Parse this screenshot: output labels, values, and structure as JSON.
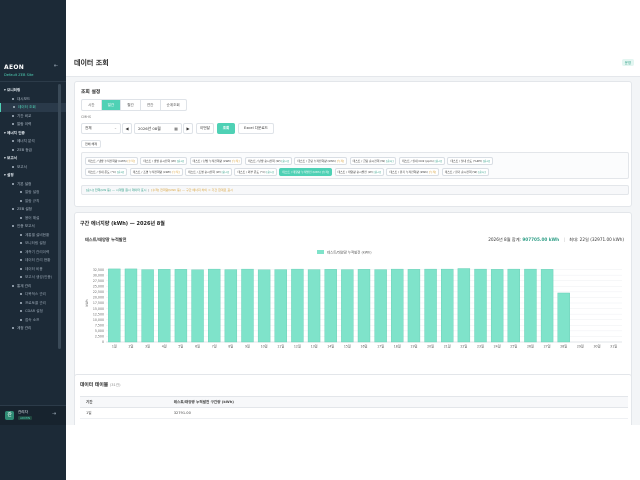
{
  "app": {
    "logo": "AEON",
    "site": "Default ZEB Site",
    "collapse_icon": "chevron-left-icon"
  },
  "sidebar": {
    "items": [
      {
        "label": "모니터링",
        "type": "group"
      },
      {
        "label": "대시보드",
        "type": "item"
      },
      {
        "label": "데이터 조회",
        "type": "item",
        "active": true
      },
      {
        "label": "기간 비교",
        "type": "item"
      },
      {
        "label": "알람 이력",
        "type": "item"
      },
      {
        "label": "에너지 인증",
        "type": "group"
      },
      {
        "label": "에너지 분석",
        "type": "item"
      },
      {
        "label": "ZEB 등급",
        "type": "item"
      },
      {
        "label": "보고서",
        "type": "group"
      },
      {
        "label": "보고서",
        "type": "item"
      },
      {
        "label": "설정",
        "type": "group"
      },
      {
        "label": "기본 설정",
        "type": "item"
      },
      {
        "label": "알람 설정",
        "type": "sub"
      },
      {
        "label": "알람 규칙",
        "type": "sub"
      },
      {
        "label": "ZEB 설정",
        "type": "item"
      },
      {
        "label": "용어 해설",
        "type": "sub"
      },
      {
        "label": "인증 보고서",
        "type": "item"
      },
      {
        "label": "계통별 설비현황",
        "type": "sub"
      },
      {
        "label": "모니터링 설정",
        "type": "sub"
      },
      {
        "label": "계측기 관리이력",
        "type": "sub"
      },
      {
        "label": "데이터 관리 현황",
        "type": "sub"
      },
      {
        "label": "데이터 비용",
        "type": "sub"
      },
      {
        "label": "보고서 생성(인증)",
        "type": "sub"
      },
      {
        "label": "통계 관리",
        "type": "item"
      },
      {
        "label": "다목적스 관리",
        "type": "sub"
      },
      {
        "label": "프로토콜 관리",
        "type": "sub"
      },
      {
        "label": "CDAR 설정",
        "type": "sub"
      },
      {
        "label": "접속 소프",
        "type": "sub"
      },
      {
        "label": "계정 관리",
        "type": "item"
      }
    ],
    "user": {
      "avatar": "관",
      "name": "관리자",
      "role": "ADMIN",
      "logout_icon": "logout-icon"
    }
  },
  "page": {
    "title": "데이터 조회",
    "env_badge": "운영"
  },
  "query": {
    "title": "조회 설정",
    "tabs": [
      "시간",
      "일간",
      "월간",
      "연간",
      "순계조회"
    ],
    "active_tab": "일간",
    "category_label": "CMHS",
    "category_value": "전체",
    "month_value": "2026년 08월",
    "this_month": "이번달",
    "search": "조회",
    "excel": "Excel 다운로드",
    "select_all": "전체 해제",
    "tags_row1": [
      {
        "label": "테스트 / 냉방 누적전력량 (kWh)",
        "unit": "[누적]",
        "warn": true
      },
      {
        "label": "테스트 / 냉방 순시전력 (W)",
        "unit": "[순시]"
      },
      {
        "label": "테스트 / 난방 누적전력량 (kWh)",
        "unit": "[누적]",
        "warn": true
      },
      {
        "label": "테스트 / 난방 순시전력 (W)",
        "unit": "[순시]"
      },
      {
        "label": "테스트 / 급탕 누적전력량 (kWh)",
        "unit": "[누적]",
        "warn": true
      },
      {
        "label": "테스트 / 급탕 순시전력 (W)",
        "unit": "[순시]"
      },
      {
        "label": "테스트 / 실내 CO2 (ppm)",
        "unit": "[순시]"
      },
      {
        "label": "테스트 / 실내 습도 (%RH)",
        "unit": "[순시]"
      }
    ],
    "tags_row2": [
      {
        "label": "테스트 / 실내 온도 (°C)",
        "unit": "[순시]"
      },
      {
        "label": "테스트 / 조명 누적전력량 (kWh)",
        "unit": "[누적]",
        "warn": true
      },
      {
        "label": "테스트 / 조명 순시전력 (W)",
        "unit": "[순시]"
      },
      {
        "label": "테스트 / 외부 온도 (°C)",
        "unit": "[순시]"
      },
      {
        "label": "테스트 / 태양광 누적발전 (kWh)",
        "unit": "[누적]",
        "selected": true
      },
      {
        "label": "테스트 / 태양광 순시발전 (W)",
        "unit": "[순시]"
      },
      {
        "label": "테스트 / 환기 누적전력량 (kWh)",
        "unit": "[누적]",
        "warn": true
      },
      {
        "label": "테스트 / 환기 순시전력 (W)",
        "unit": "[순시]"
      }
    ],
    "hint_a": "[순시] 전력(kW 등) — 시계열 원시 데이터 표시",
    "hint_b": "[누적] 전력량(kWh 등) — 구간 에너지 차이 = 기간 합계로 표시"
  },
  "chart_section": {
    "heading": "구간 에너지량 (kWh) — 2026년 8월",
    "sub": "테스트/태양광 누적발전",
    "total_label": "2026년 8월 합계:",
    "total_value": "907705.00 kWh",
    "max_label": "최대: 22일 (32971.00 kWh)"
  },
  "chart_data": {
    "type": "bar",
    "legend": [
      "테스트/태양광 누적발전 (kWh)"
    ],
    "ylabel": "kWh",
    "ylim": [
      0,
      35000
    ],
    "yticks": [
      "0",
      "2,500",
      "5,000",
      "7,500",
      "10,000",
      "12,500",
      "15,000",
      "17,500",
      "20,000",
      "22,500",
      "25,000",
      "27,500",
      "30,000",
      "32,500"
    ],
    "ytick_values": [
      0,
      2500,
      5000,
      7500,
      10000,
      12500,
      15000,
      17500,
      20000,
      22500,
      25000,
      27500,
      30000,
      32500
    ],
    "categories": [
      "1일",
      "2일",
      "3일",
      "4일",
      "5일",
      "6일",
      "7일",
      "8일",
      "9일",
      "10일",
      "11일",
      "12일",
      "13일",
      "14일",
      "15일",
      "16일",
      "17일",
      "18일",
      "19일",
      "20일",
      "21일",
      "22일",
      "23일",
      "24일",
      "25일",
      "26일",
      "27일",
      "28일",
      "29일",
      "30일",
      "31일"
    ],
    "values": [
      32800,
      32800,
      32500,
      32600,
      32600,
      32400,
      32700,
      32500,
      32700,
      32400,
      32500,
      32700,
      32500,
      32600,
      32500,
      32600,
      32500,
      32700,
      32600,
      32700,
      32700,
      32971,
      32700,
      32600,
      32700,
      32700,
      32600,
      22000,
      0,
      0,
      0
    ],
    "grid": true,
    "legend_position": "top-center",
    "color": "#7fe3ca"
  },
  "table": {
    "title": "데이터 테이블",
    "count": "(31건)",
    "columns": [
      "기간",
      "테스트/태양광 누적발전 구간량 (kWh)"
    ],
    "rows": [
      [
        "1일",
        "32791.00"
      ]
    ]
  }
}
